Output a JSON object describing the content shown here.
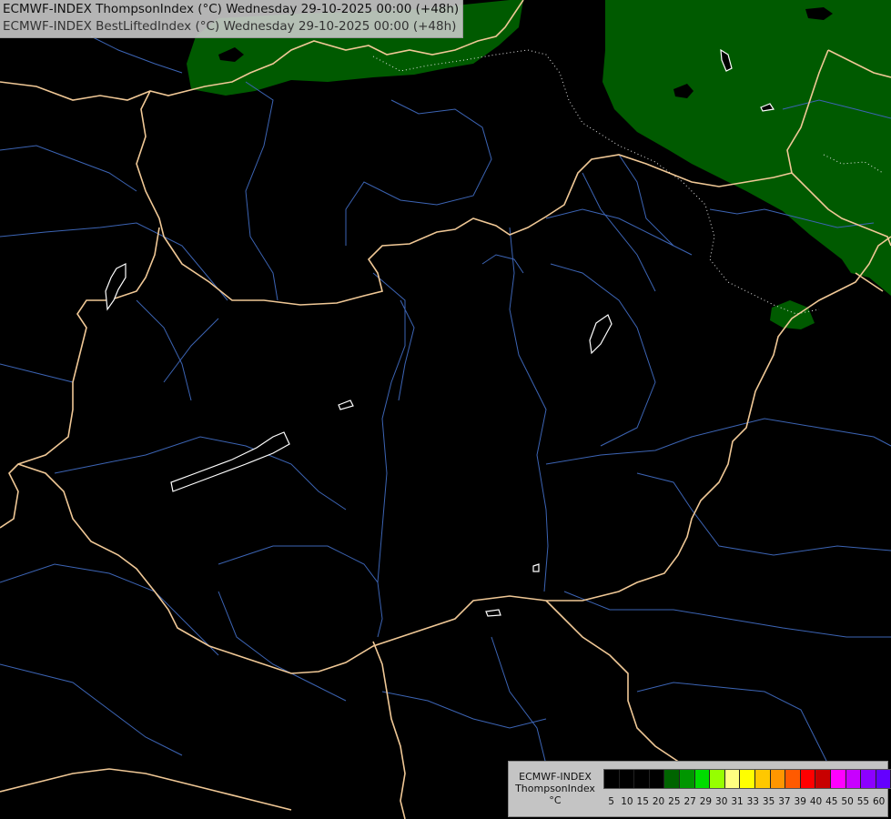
{
  "header": {
    "line1": "ECMWF-INDEX ThompsonIndex (°C) Wednesday 29-10-2025 00:00 (+48h)",
    "line2": "ECMWF-INDEX BestLiftedIndex (°C) Wednesday 29-10-2025 00:00 (+48h)"
  },
  "legend": {
    "title_line1": "ECMWF-INDEX",
    "title_line2": "ThompsonIndex",
    "unit": "°C",
    "swatches": [
      "#000000",
      "#000000",
      "#000000",
      "#000000",
      "#006400",
      "#009600",
      "#00dc00",
      "#96ff00",
      "#ffff80",
      "#ffff00",
      "#ffc800",
      "#ff9600",
      "#ff5a00",
      "#ff0000",
      "#c80000",
      "#ff00ff",
      "#c800ff",
      "#8c00ff",
      "#6400ff",
      "#0000ff"
    ],
    "ticks": [
      "5",
      "10",
      "15",
      "20",
      "25",
      "27",
      "29",
      "30",
      "31",
      "33",
      "35",
      "37",
      "39",
      "40",
      "45",
      "50",
      "55",
      "60"
    ]
  },
  "colors": {
    "background": "#000000",
    "field_fill": "#005a00",
    "borders": "#f0c896",
    "rivers": "#3c64b4",
    "lakes": "#ffffff"
  }
}
